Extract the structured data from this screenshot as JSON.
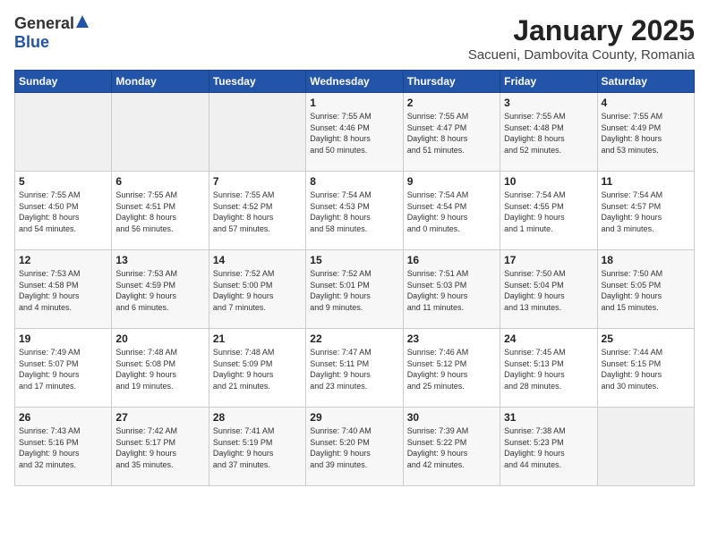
{
  "header": {
    "logo_general": "General",
    "logo_blue": "Blue",
    "title": "January 2025",
    "location": "Sacueni, Dambovita County, Romania"
  },
  "weekdays": [
    "Sunday",
    "Monday",
    "Tuesday",
    "Wednesday",
    "Thursday",
    "Friday",
    "Saturday"
  ],
  "weeks": [
    [
      {
        "day": "",
        "detail": ""
      },
      {
        "day": "",
        "detail": ""
      },
      {
        "day": "",
        "detail": ""
      },
      {
        "day": "1",
        "detail": "Sunrise: 7:55 AM\nSunset: 4:46 PM\nDaylight: 8 hours\nand 50 minutes."
      },
      {
        "day": "2",
        "detail": "Sunrise: 7:55 AM\nSunset: 4:47 PM\nDaylight: 8 hours\nand 51 minutes."
      },
      {
        "day": "3",
        "detail": "Sunrise: 7:55 AM\nSunset: 4:48 PM\nDaylight: 8 hours\nand 52 minutes."
      },
      {
        "day": "4",
        "detail": "Sunrise: 7:55 AM\nSunset: 4:49 PM\nDaylight: 8 hours\nand 53 minutes."
      }
    ],
    [
      {
        "day": "5",
        "detail": "Sunrise: 7:55 AM\nSunset: 4:50 PM\nDaylight: 8 hours\nand 54 minutes."
      },
      {
        "day": "6",
        "detail": "Sunrise: 7:55 AM\nSunset: 4:51 PM\nDaylight: 8 hours\nand 56 minutes."
      },
      {
        "day": "7",
        "detail": "Sunrise: 7:55 AM\nSunset: 4:52 PM\nDaylight: 8 hours\nand 57 minutes."
      },
      {
        "day": "8",
        "detail": "Sunrise: 7:54 AM\nSunset: 4:53 PM\nDaylight: 8 hours\nand 58 minutes."
      },
      {
        "day": "9",
        "detail": "Sunrise: 7:54 AM\nSunset: 4:54 PM\nDaylight: 9 hours\nand 0 minutes."
      },
      {
        "day": "10",
        "detail": "Sunrise: 7:54 AM\nSunset: 4:55 PM\nDaylight: 9 hours\nand 1 minute."
      },
      {
        "day": "11",
        "detail": "Sunrise: 7:54 AM\nSunset: 4:57 PM\nDaylight: 9 hours\nand 3 minutes."
      }
    ],
    [
      {
        "day": "12",
        "detail": "Sunrise: 7:53 AM\nSunset: 4:58 PM\nDaylight: 9 hours\nand 4 minutes."
      },
      {
        "day": "13",
        "detail": "Sunrise: 7:53 AM\nSunset: 4:59 PM\nDaylight: 9 hours\nand 6 minutes."
      },
      {
        "day": "14",
        "detail": "Sunrise: 7:52 AM\nSunset: 5:00 PM\nDaylight: 9 hours\nand 7 minutes."
      },
      {
        "day": "15",
        "detail": "Sunrise: 7:52 AM\nSunset: 5:01 PM\nDaylight: 9 hours\nand 9 minutes."
      },
      {
        "day": "16",
        "detail": "Sunrise: 7:51 AM\nSunset: 5:03 PM\nDaylight: 9 hours\nand 11 minutes."
      },
      {
        "day": "17",
        "detail": "Sunrise: 7:50 AM\nSunset: 5:04 PM\nDaylight: 9 hours\nand 13 minutes."
      },
      {
        "day": "18",
        "detail": "Sunrise: 7:50 AM\nSunset: 5:05 PM\nDaylight: 9 hours\nand 15 minutes."
      }
    ],
    [
      {
        "day": "19",
        "detail": "Sunrise: 7:49 AM\nSunset: 5:07 PM\nDaylight: 9 hours\nand 17 minutes."
      },
      {
        "day": "20",
        "detail": "Sunrise: 7:48 AM\nSunset: 5:08 PM\nDaylight: 9 hours\nand 19 minutes."
      },
      {
        "day": "21",
        "detail": "Sunrise: 7:48 AM\nSunset: 5:09 PM\nDaylight: 9 hours\nand 21 minutes."
      },
      {
        "day": "22",
        "detail": "Sunrise: 7:47 AM\nSunset: 5:11 PM\nDaylight: 9 hours\nand 23 minutes."
      },
      {
        "day": "23",
        "detail": "Sunrise: 7:46 AM\nSunset: 5:12 PM\nDaylight: 9 hours\nand 25 minutes."
      },
      {
        "day": "24",
        "detail": "Sunrise: 7:45 AM\nSunset: 5:13 PM\nDaylight: 9 hours\nand 28 minutes."
      },
      {
        "day": "25",
        "detail": "Sunrise: 7:44 AM\nSunset: 5:15 PM\nDaylight: 9 hours\nand 30 minutes."
      }
    ],
    [
      {
        "day": "26",
        "detail": "Sunrise: 7:43 AM\nSunset: 5:16 PM\nDaylight: 9 hours\nand 32 minutes."
      },
      {
        "day": "27",
        "detail": "Sunrise: 7:42 AM\nSunset: 5:17 PM\nDaylight: 9 hours\nand 35 minutes."
      },
      {
        "day": "28",
        "detail": "Sunrise: 7:41 AM\nSunset: 5:19 PM\nDaylight: 9 hours\nand 37 minutes."
      },
      {
        "day": "29",
        "detail": "Sunrise: 7:40 AM\nSunset: 5:20 PM\nDaylight: 9 hours\nand 39 minutes."
      },
      {
        "day": "30",
        "detail": "Sunrise: 7:39 AM\nSunset: 5:22 PM\nDaylight: 9 hours\nand 42 minutes."
      },
      {
        "day": "31",
        "detail": "Sunrise: 7:38 AM\nSunset: 5:23 PM\nDaylight: 9 hours\nand 44 minutes."
      },
      {
        "day": "",
        "detail": ""
      }
    ]
  ]
}
